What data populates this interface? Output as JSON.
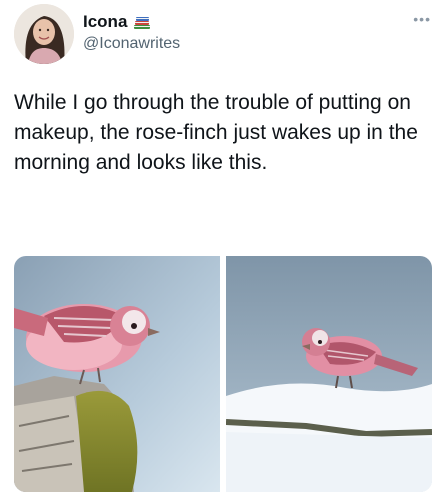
{
  "author": {
    "name": "Icona",
    "handle": "@Iconawrites",
    "name_emoji": "books-icon"
  },
  "tweet": {
    "text": "While I go through the trouble of putting on makeup, the rose-finch just wakes up in the morning and looks like this."
  },
  "icons": {
    "more": "more-icon"
  },
  "media": {
    "photos": [
      {
        "subject": "rose-finch perched on mossy log"
      },
      {
        "subject": "rose-finch standing on snow-covered branch"
      }
    ]
  }
}
